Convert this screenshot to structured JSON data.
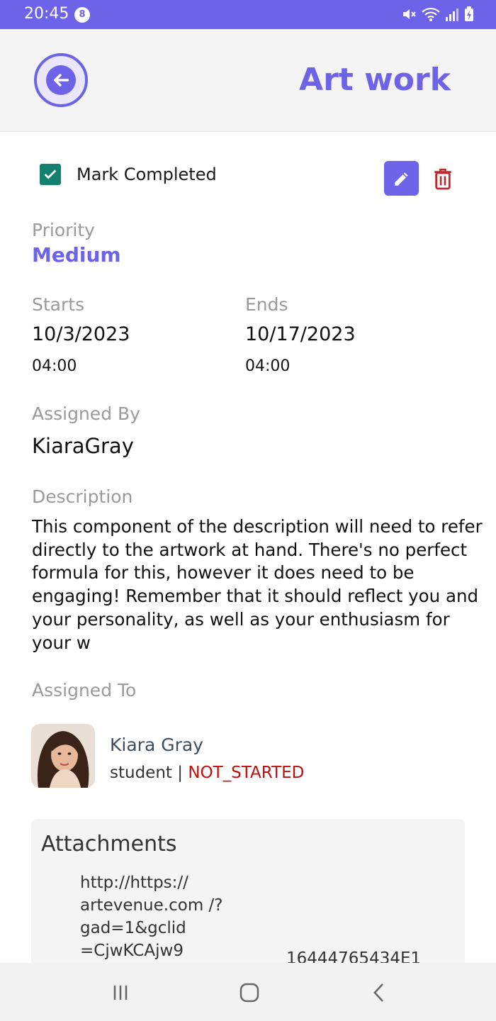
{
  "status_bar": {
    "time": "20:45",
    "notification_count": "8"
  },
  "header": {
    "title": "Art work"
  },
  "task": {
    "mark_completed_label": "Mark Completed",
    "completed": true,
    "priority_label": "Priority",
    "priority_value": "Medium",
    "starts_label": "Starts",
    "start_date": "10/3/2023",
    "start_time": "04:00",
    "ends_label": "Ends",
    "end_date": "10/17/2023",
    "end_time": "04:00",
    "assigned_by_label": "Assigned By",
    "assigned_by_value": "KiaraGray",
    "description_label": "Description",
    "description_text": "This component of the description will need to refer directly to the artwork at hand. There's no perfect formula for this, however it does need to be engaging! Remember that it should reflect you and your personality, as well as your enthusiasm for your w",
    "assigned_to_label": "Assigned To"
  },
  "assignee": {
    "name": "Kiara Gray",
    "role": "student",
    "separator": " | ",
    "status": "NOT_STARTED"
  },
  "attachments": {
    "title": "Attachments",
    "url": "http://https:// artevenue.com /?gad=1&gclid =CjwKCAjw9",
    "id_fragment": "16444765434E1"
  },
  "colors": {
    "accent": "#6c63e8",
    "checkbox": "#14806d",
    "delete": "#c0282d",
    "status_red": "#c40d0d"
  },
  "icons": {
    "back": "arrow-left-icon",
    "edit": "pencil-icon",
    "delete": "trash-icon",
    "check": "check-icon"
  }
}
